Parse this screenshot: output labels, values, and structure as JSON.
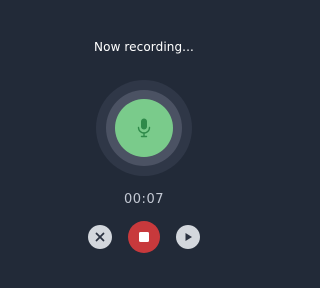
{
  "recorder": {
    "status_text": "Now recording...",
    "timer": "00:07"
  },
  "icons": {
    "mic": "microphone-icon",
    "cancel": "close-icon",
    "stop": "stop-icon",
    "play": "play-icon"
  },
  "colors": {
    "background": "#222a38",
    "mic_circle": "#7acb8b",
    "mic_icon": "#2f8a4a",
    "stop_button": "#c8393c",
    "control_button": "#d3d7dd",
    "control_icon": "#2a3140"
  }
}
